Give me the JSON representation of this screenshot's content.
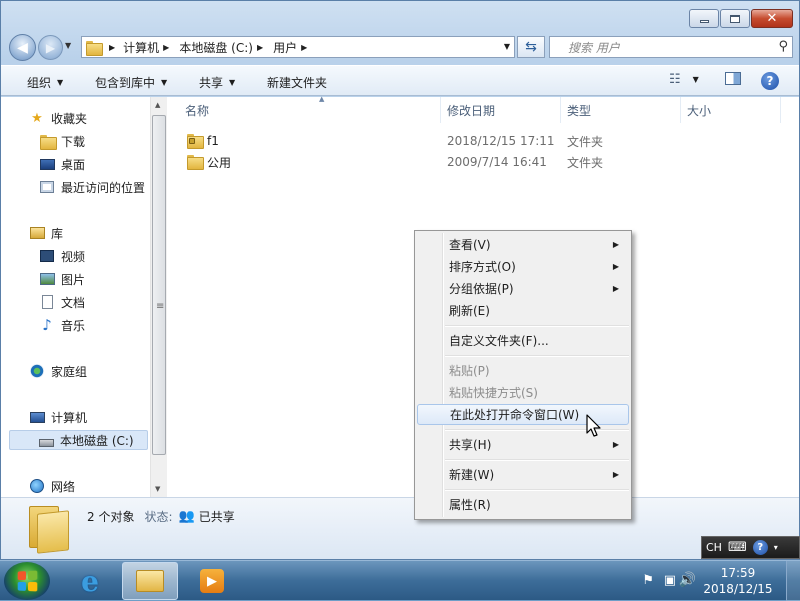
{
  "address": {
    "crumbs": [
      "计算机",
      "本地磁盘 (C:)",
      "用户"
    ],
    "search_placeholder": "搜索 用户"
  },
  "toolbar": {
    "organize": "组织",
    "include_in_library": "包含到库中",
    "share": "共享",
    "new_folder": "新建文件夹"
  },
  "nav": {
    "favorites": "收藏夹",
    "downloads": "下载",
    "desktop": "桌面",
    "recent": "最近访问的位置",
    "libraries": "库",
    "videos": "视频",
    "pictures": "图片",
    "documents": "文档",
    "music": "音乐",
    "homegroup": "家庭组",
    "computer": "计算机",
    "local_disk": "本地磁盘 (C:)",
    "network": "网络"
  },
  "columns": {
    "name": "名称",
    "date": "修改日期",
    "type": "类型",
    "size": "大小"
  },
  "files": [
    {
      "name": "f1",
      "date": "2018/12/15 17:11",
      "type": "文件夹"
    },
    {
      "name": "公用",
      "date": "2009/7/14 16:41",
      "type": "文件夹"
    }
  ],
  "details": {
    "count": "2 个对象",
    "state_label": "状态:",
    "state_value": "已共享"
  },
  "context_menu": {
    "view": "查看(V)",
    "sort": "排序方式(O)",
    "group": "分组依据(P)",
    "refresh": "刷新(E)",
    "customize": "自定义文件夹(F)...",
    "paste": "粘贴(P)",
    "paste_shortcut": "粘贴快捷方式(S)",
    "open_cmd": "在此处打开命令窗口(W)",
    "share": "共享(H)",
    "new": "新建(W)",
    "properties": "属性(R)"
  },
  "langbar": {
    "lang": "CH"
  },
  "clock": {
    "time": "17:59",
    "date": "2018/12/15"
  }
}
